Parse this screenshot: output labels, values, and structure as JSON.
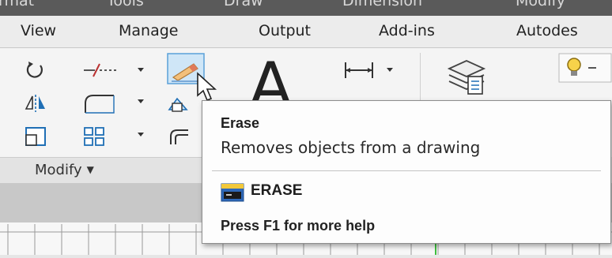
{
  "menubar": {
    "items": [
      "rmat",
      "Tools",
      "Draw",
      "Dimension",
      "Modify"
    ]
  },
  "ribbon_tabs": [
    "View",
    "Manage",
    "Output",
    "Add-ins",
    "Autodes"
  ],
  "ribbon": {
    "modify_panel_title": "Modify",
    "large_text_tool_glyph": "A"
  },
  "tooltip": {
    "title": "Erase",
    "description": "Removes objects from a drawing",
    "command": "ERASE",
    "help": "Press F1 for more help"
  },
  "icons": {
    "rotate": "rotate-icon",
    "trim": "trim-icon",
    "erase": "eraser-icon",
    "mirror": "mirror-icon",
    "fillet": "fillet-icon",
    "array": "array-icon",
    "linear_dimension": "linear-dimension-icon",
    "layers": "layer-properties-icon",
    "light": "lightbulb-icon"
  },
  "colors": {
    "accent_blue": "#1f6fb5",
    "highlight": "#cfe6f7",
    "highlight_border": "#5aa0d8"
  }
}
